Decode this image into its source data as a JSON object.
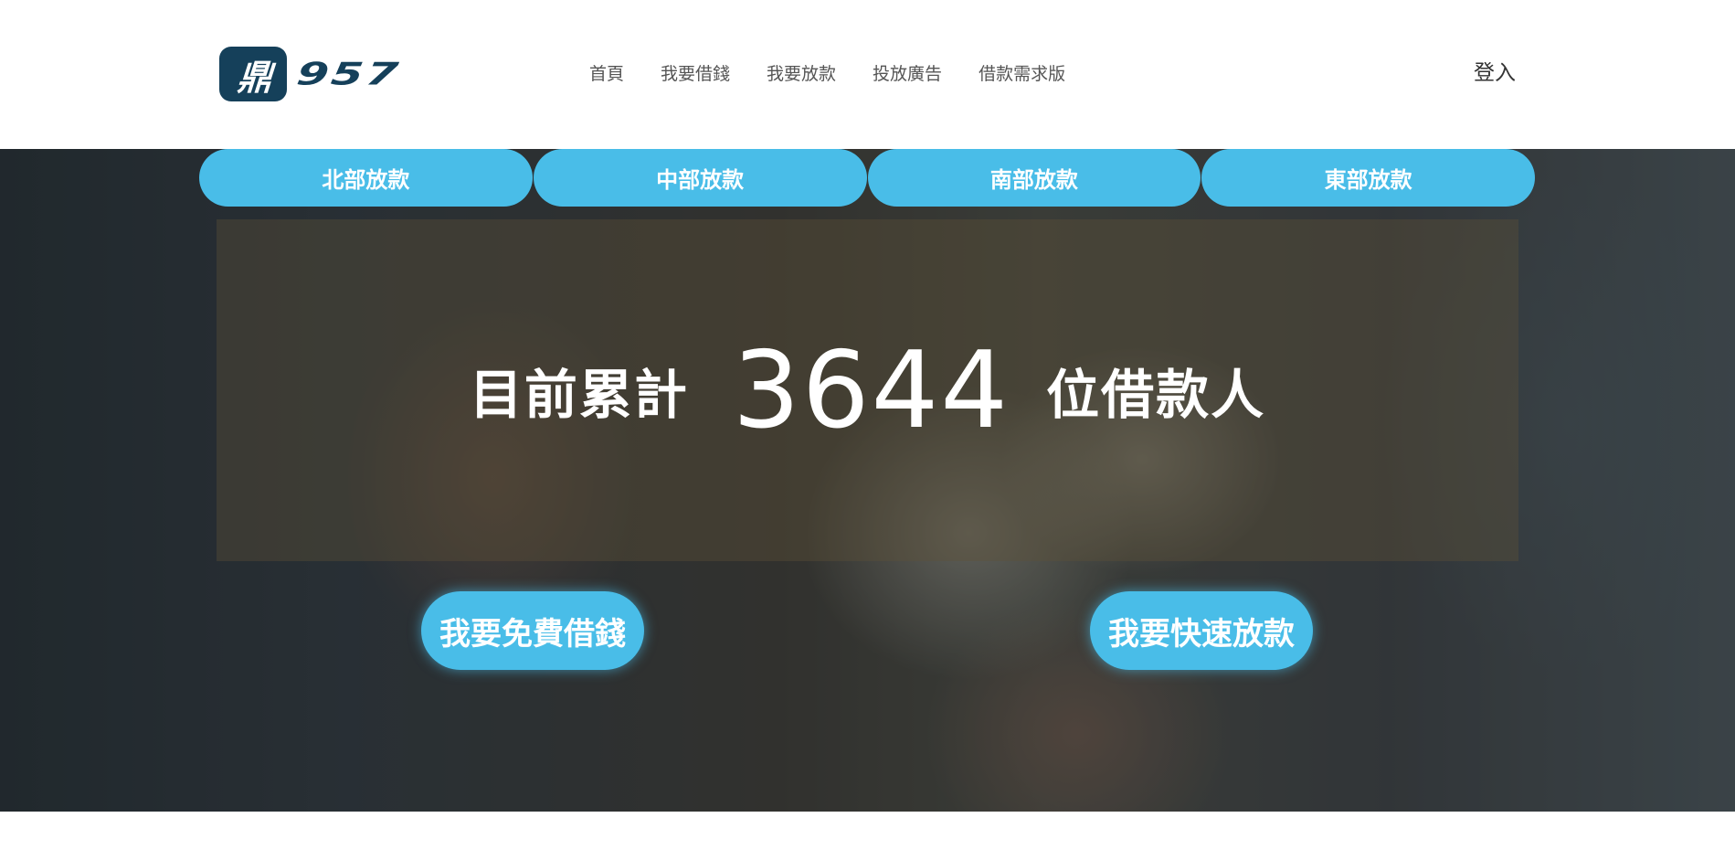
{
  "header": {
    "logo": {
      "badge": "鼎",
      "text": "957"
    },
    "nav": [
      {
        "label": "首頁"
      },
      {
        "label": "我要借錢"
      },
      {
        "label": "我要放款"
      },
      {
        "label": "投放廣告"
      },
      {
        "label": "借款需求版"
      }
    ],
    "login_label": "登入"
  },
  "hero": {
    "region_tabs": [
      {
        "label": "北部放款"
      },
      {
        "label": "中部放款"
      },
      {
        "label": "南部放款"
      },
      {
        "label": "東部放款"
      }
    ],
    "stats": {
      "prefix": "目前累計",
      "count": "3644",
      "suffix": "位借款人"
    },
    "cta_borrow": "我要免費借錢",
    "cta_lend": "我要快速放款"
  },
  "colors": {
    "accent": "#49bde8",
    "brand": "#15405a",
    "nav_text": "#555555"
  }
}
